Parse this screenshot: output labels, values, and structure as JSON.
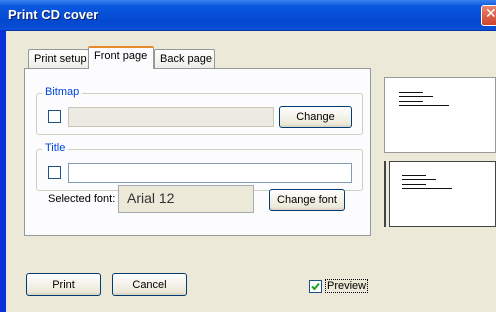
{
  "window": {
    "title": "Print CD cover",
    "close_glyph": "✕"
  },
  "tabs": [
    {
      "label": "Print setup",
      "active": false
    },
    {
      "label": "Front page",
      "active": true
    },
    {
      "label": "Back page",
      "active": false
    }
  ],
  "bitmap_group": {
    "legend": "Bitmap",
    "checked": false,
    "path_value": "",
    "change_label": "Change"
  },
  "title_group": {
    "legend": "Title",
    "checked": false,
    "title_value": ""
  },
  "font": {
    "label": "Selected font:",
    "value": "Arial 12",
    "change_label": "Change font"
  },
  "footer": {
    "print_label": "Print",
    "cancel_label": "Cancel",
    "preview_label": "Preview",
    "preview_checked": true
  },
  "colors": {
    "titlebar": "#0548d0",
    "group_legend": "#0046d5",
    "dialog_bg": "#ece9d8",
    "checkmark": "#21a121"
  }
}
